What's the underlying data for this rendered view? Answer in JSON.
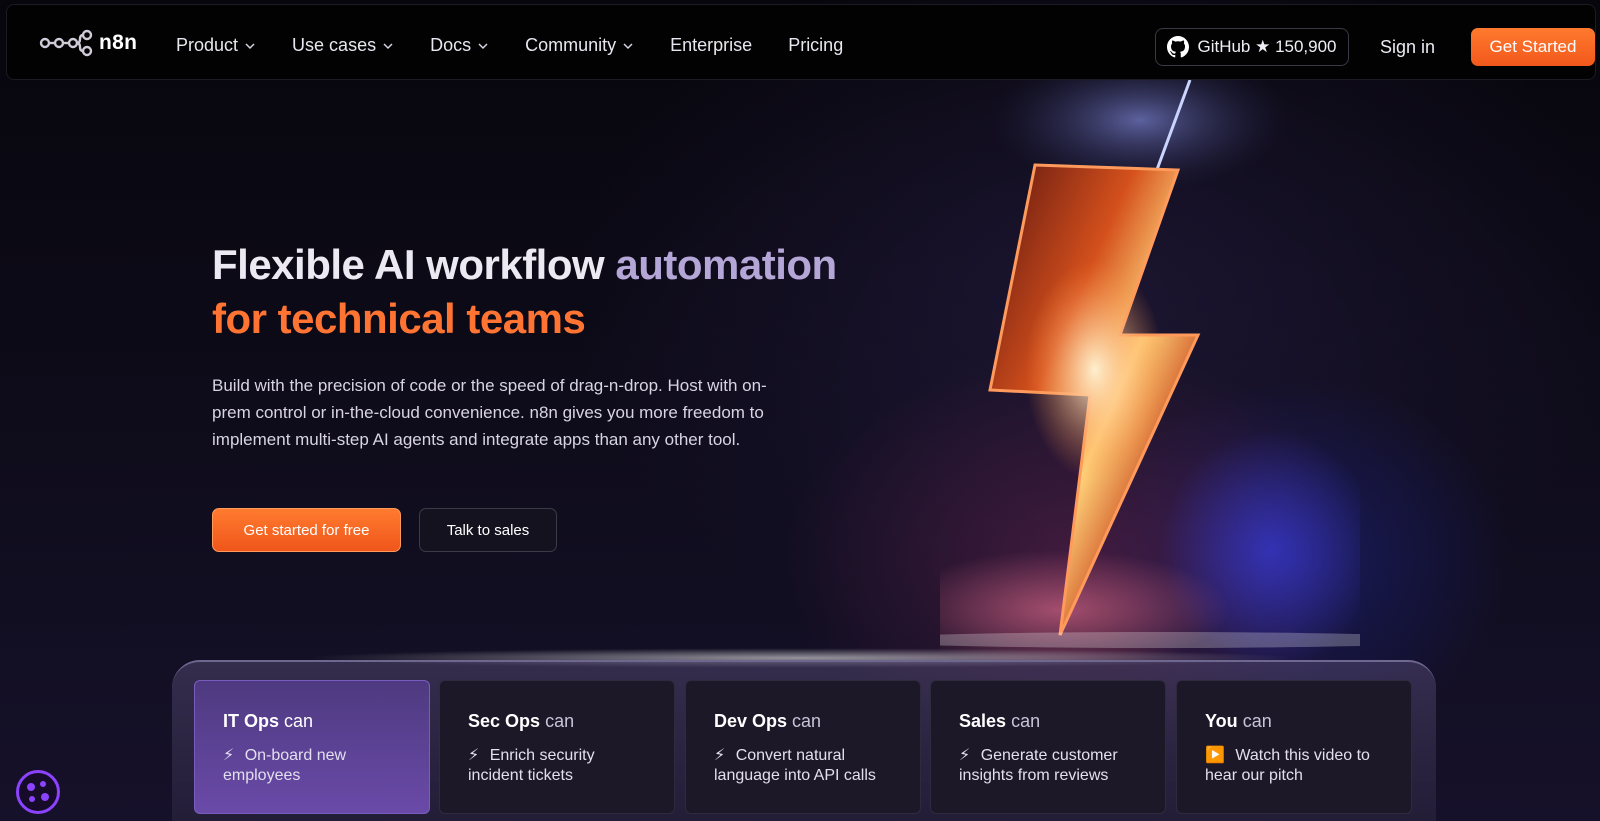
{
  "nav": {
    "logo_text": "n8n",
    "menu": [
      {
        "label": "Product",
        "dropdown": true
      },
      {
        "label": "Use cases",
        "dropdown": true
      },
      {
        "label": "Docs",
        "dropdown": true
      },
      {
        "label": "Community",
        "dropdown": true
      },
      {
        "label": "Enterprise",
        "dropdown": false
      },
      {
        "label": "Pricing",
        "dropdown": false
      }
    ],
    "github_label": "GitHub ★ 150,900",
    "signin_label": "Sign in",
    "get_started_label": "Get Started"
  },
  "hero": {
    "title_part1": "Flexible AI workflow ",
    "title_part2": "automation",
    "title_part3": "for technical teams",
    "description": "Build with the precision of code or the speed of drag-n-drop. Host with on-prem control or in-the-cloud convenience. n8n gives you more freedom to implement multi-step AI agents and integrate apps than any other tool.",
    "primary_button": "Get started for free",
    "secondary_button": "Talk to sales"
  },
  "cards": [
    {
      "role": "IT Ops",
      "can": "can",
      "icon": "⚡",
      "text": "On-board new employees",
      "active": true
    },
    {
      "role": "Sec Ops",
      "can": "can",
      "icon": "⚡",
      "text": "Enrich security incident tickets",
      "active": false
    },
    {
      "role": "Dev Ops",
      "can": "can",
      "icon": "⚡",
      "text": "Convert natural language into API calls",
      "active": false
    },
    {
      "role": "Sales",
      "can": "can",
      "icon": "⚡",
      "text": "Generate customer insights from reviews",
      "active": false
    },
    {
      "role": "You",
      "can": "can",
      "icon": "▶️",
      "text": "Watch this video to hear our pitch",
      "active": false
    }
  ],
  "colors": {
    "accent_orange": "#ff7433",
    "accent_purple": "#6a4aa8",
    "background": "#0d0a18"
  }
}
